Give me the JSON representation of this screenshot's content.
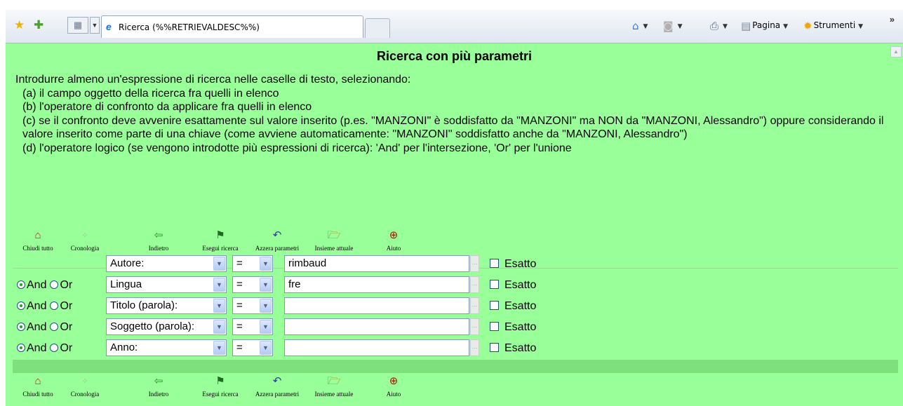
{
  "browser": {
    "tab_title": "Ricerca (%%RETRIEVALDESC%%)",
    "commands": {
      "page_label": "Pagina",
      "tools_label": "Strumenti"
    }
  },
  "page": {
    "title": "Ricerca con più parametri",
    "intro": [
      "Introdurre almeno un'espressione di ricerca nelle caselle di testo, selezionando:",
      "(a) il campo oggetto della ricerca fra quelli in elenco",
      "(b) l'operatore di confronto da applicare fra quelli in elenco",
      "(c) se il confronto deve avvenire esattamente sul valore inserito (p.es. \"MANZONI\" è soddisfatto da \"MANZONI\" ma NON da \"MANZONI, Alessandro\") oppure considerando il valore inserito come parte di una chiave (come avviene automaticamente: \"MANZONI\" soddisfatto anche da \"MANZONI, Alessandro\")",
      "(d) l'operatore logico (se vengono introdotte più espressioni di ricerca): 'And' per l'intersezione, 'Or' per l'unione"
    ]
  },
  "toolbar": {
    "close_all": "Chiudi tutto",
    "history": "Cronologia",
    "back": "Indietro",
    "run_search": "Esegui ricerca",
    "reset_params": "Azzera parametri",
    "current_set": "Insieme attuale",
    "help": "Aiuto"
  },
  "form": {
    "logic_and": "And",
    "logic_or": "Or",
    "exact_label": "Esatto",
    "rows": [
      {
        "field": "Autore:",
        "operator": "=",
        "value": "rimbaud"
      },
      {
        "field": "Lingua",
        "operator": "=",
        "value": "fre"
      },
      {
        "field": "Titolo (parola):",
        "operator": "=",
        "value": ""
      },
      {
        "field": "Soggetto (parola):",
        "operator": "=",
        "value": ""
      },
      {
        "field": "Anno:",
        "operator": "=",
        "value": ""
      }
    ]
  }
}
